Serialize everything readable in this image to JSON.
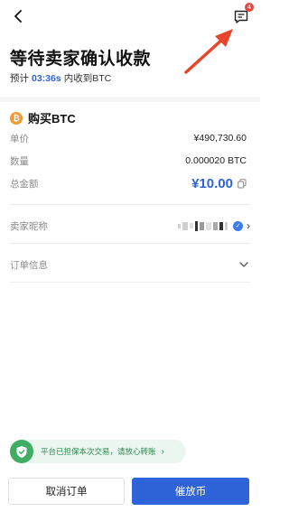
{
  "header": {
    "back_icon": "chevron-left-icon",
    "message_icon": "message-list-icon",
    "message_badge": "4"
  },
  "status": {
    "title": "等待卖家确认收款",
    "expect_prefix": "预计",
    "timer": "03:36s",
    "expect_suffix": "内收到BTC"
  },
  "order": {
    "section_title": "购买BTC",
    "coin_icon": "bitcoin-icon",
    "unit_price_label": "单价",
    "unit_price_value": "¥490,730.60",
    "quantity_label": "数量",
    "quantity_value": "0.000020 BTC",
    "total_label": "总金额",
    "total_value": "¥10.00"
  },
  "seller": {
    "label": "卖家昵称"
  },
  "order_info": {
    "label": "订单信息"
  },
  "assurance": {
    "text": "平台已担保本次交易，请放心转账"
  },
  "actions": {
    "cancel_label": "取消订单",
    "urge_label": "催放币"
  },
  "colors": {
    "accent": "#2f63d8",
    "annotation_arrow": "#e8452c",
    "assurance_green": "#3fae64",
    "bitcoin_orange": "#f29a33"
  }
}
